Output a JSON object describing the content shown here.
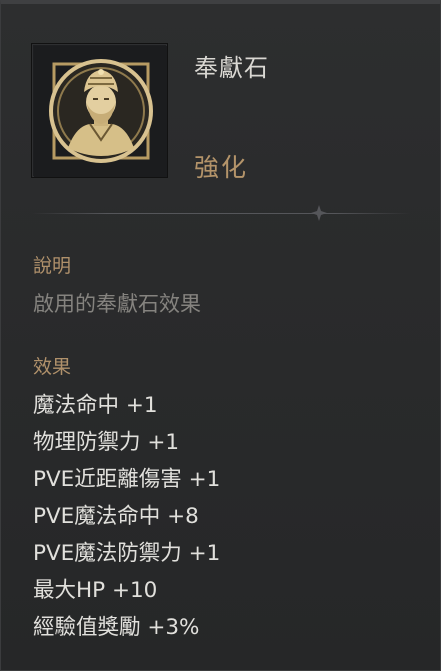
{
  "item": {
    "name": "奉獻石",
    "category": "強化",
    "icon": "offering-stone-portrait-icon"
  },
  "description": {
    "heading": "說明",
    "text": "啟用的奉獻石效果"
  },
  "effects": {
    "heading": "效果",
    "items": [
      "魔法命中 +1",
      "物理防禦力 +1",
      "PVE近距離傷害 +1",
      "PVE魔法命中 +8",
      "PVE魔法防禦力 +1",
      "最大HP +10",
      "經驗值獎勵 +3%"
    ]
  },
  "colors": {
    "background": "#2b2c2d",
    "title": "#d9d7d2",
    "category": "#b4946a",
    "heading": "#b0916b",
    "description": "#85837f",
    "effect": "#e1e0dc",
    "icon_gold": "#d9c28e"
  }
}
